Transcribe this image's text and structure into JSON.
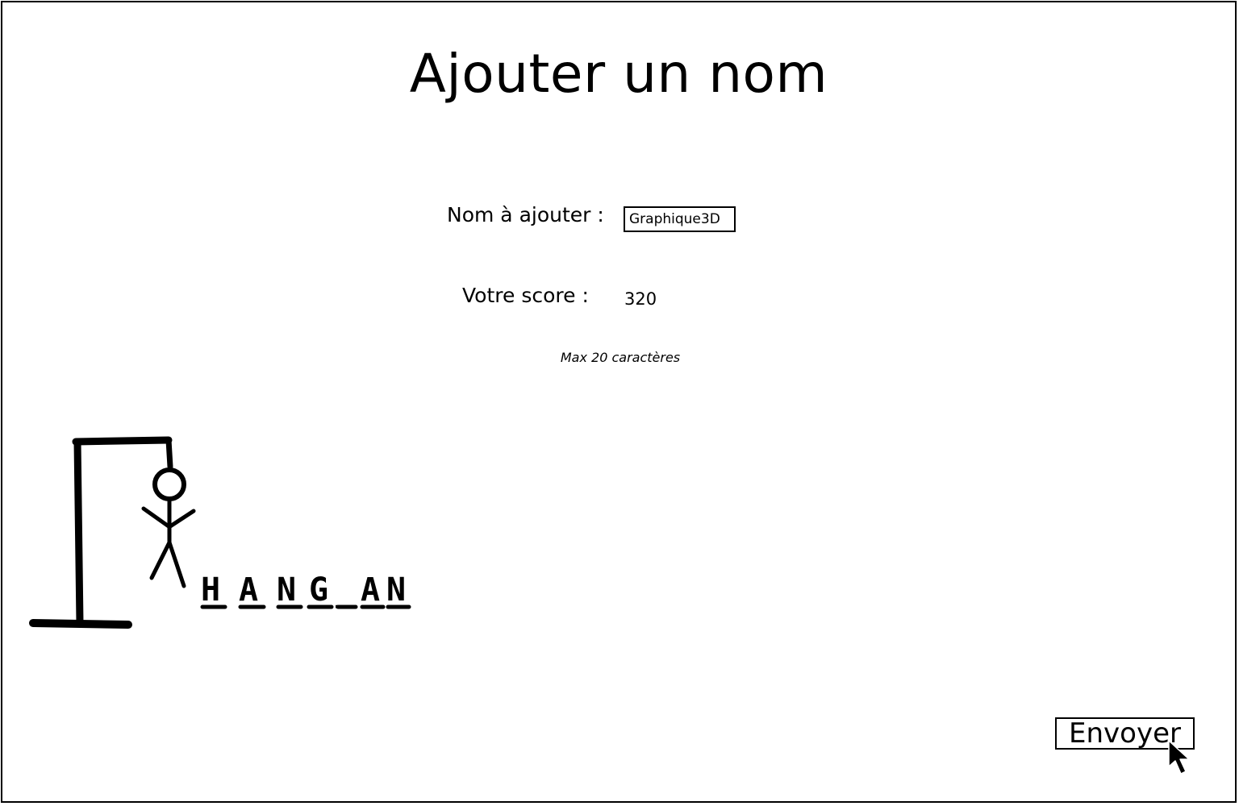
{
  "page": {
    "title": "Ajouter un nom"
  },
  "form": {
    "name_label": "Nom à ajouter :",
    "name_value": "Graphique3D",
    "score_label": "Votre score :",
    "score_value": "320",
    "hint": "Max 20 caractères"
  },
  "logo": {
    "letters": [
      "H",
      "A",
      "N",
      "G",
      "_",
      "A",
      "N"
    ],
    "icon": "hangman-gallows-icon"
  },
  "actions": {
    "send_label": "Envoyer"
  },
  "colors": {
    "ink": "#000000",
    "background": "#ffffff"
  }
}
